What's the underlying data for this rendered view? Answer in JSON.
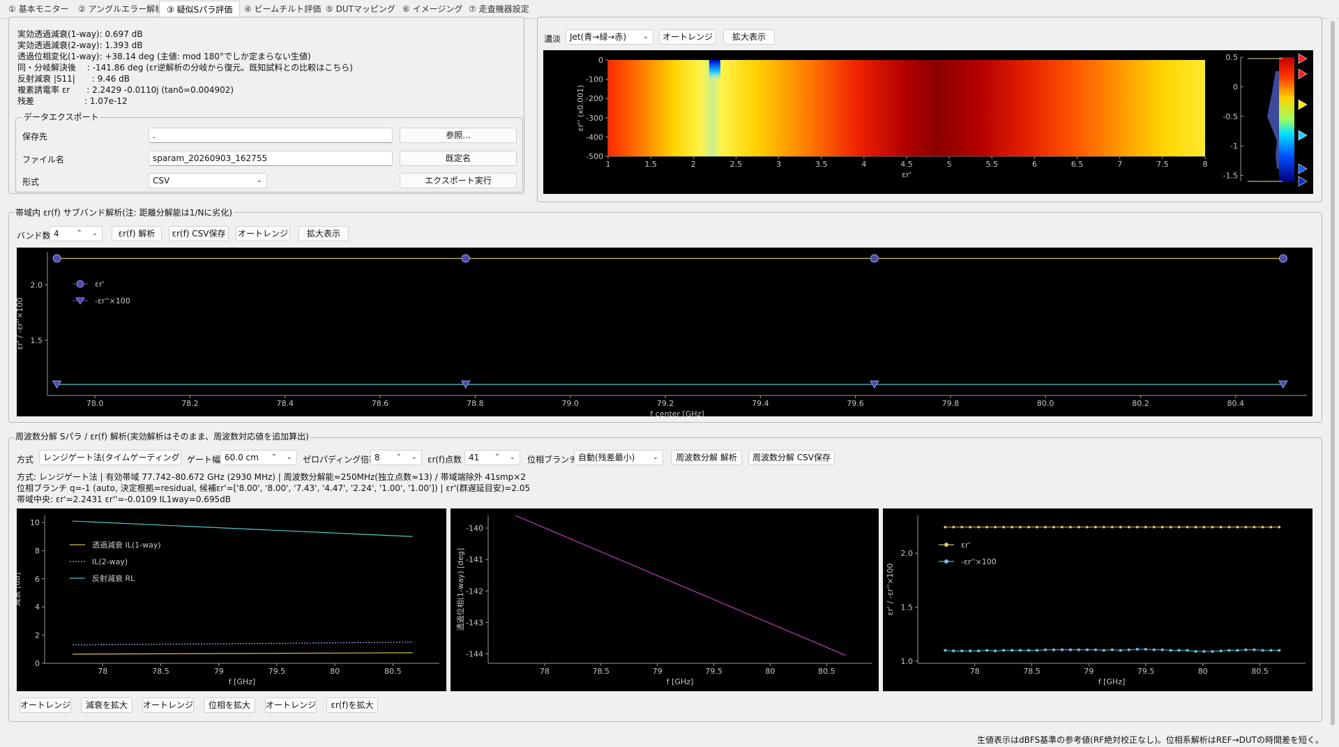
{
  "tabs": [
    "① 基本モニター",
    "② アングルエラー解析",
    "③ 疑似Sパラ評価",
    "④ ビームチルト評価",
    "⑤ DUTマッピング",
    "⑥ イメージング",
    "⑦ 走査機器設定"
  ],
  "results": {
    "lines": [
      "実効透過減衰(1-way): 0.697 dB",
      "実効透過減衰(2-way): 1.393 dB",
      "透過位相変化(1-way): +38.14 deg (主値: mod 180°でしか定まらない生値)",
      "同・分岐解決後　 : -141.86 deg (εr逆解析の分岐から復元。既知試料との比較はこちら)",
      "反射減衰 |S11|　　: 9.46 dB",
      "複素誘電率 εr　　: 2.2429 -0.0110j (tanδ=0.004902)",
      "残差　　　　　　: 1.07e-12"
    ]
  },
  "export": {
    "title": "データエクスポート",
    "save_dest_label": "保存先",
    "save_dest_value": ".",
    "browse_label": "参照...",
    "filename_label": "ファイル名",
    "filename_value": "sparam_20260903_162755",
    "default_name_label": "既定名",
    "format_label": "形式",
    "format_value": "CSV",
    "export_label": "エクスポート実行"
  },
  "heatmap_panel": {
    "colormap_label": "濃淡",
    "colormap_value": "Jet(青→緑→赤)",
    "autorange_label": "オートレンジ",
    "zoom_label": "拡大表示"
  },
  "subband": {
    "title": "帯域内 εr(f) サブバンド解析(注: 距離分解能は1/Nに劣化)",
    "bands_label": "バンド数",
    "bands_value": "4",
    "analyze_label": "εr(f) 解析",
    "csv_label": "εr(f) CSV保存",
    "autorange_label": "オートレンジ",
    "zoom_label": "拡大表示"
  },
  "freq": {
    "title": "周波数分解 Sパラ / εr(f) 解析(実効解析はそのまま、周波数対応値を追加算出)",
    "method_label": "方式",
    "method_value": "レンジゲート法(タイムゲーティング)",
    "gate_label": "ゲート幅",
    "gate_value": "60.0 cm",
    "zp_label": "ゼロパディング倍率",
    "zp_value": "8",
    "pts_label": "εr(f)点数",
    "pts_value": "41",
    "branch_label": "位相ブランチ",
    "branch_value": "自動(残差最小)",
    "analyze_label": "周波数分解 解析",
    "csv_label": "周波数分解 CSV保存",
    "info": [
      "方式: レンジゲート法 | 有効帯域 77.742–80.672 GHz (2930 MHz) | 周波数分解能≈250MHz(独立点数≈13) / 帯域端除外 41smp×2",
      "位相ブランチ q=-1 (auto, 決定根拠=residual, 候補εr'=['8.00', '8.00', '7.43', '4.47', '2.24', '1.00', '1.00']) | εr'(群遅延目安)=2.05",
      "帯域中央: εr'=2.2431 εr''=-0.0109 IL1way=0.695dB"
    ],
    "bottom_buttons": [
      "オートレンジ",
      "減衰を拡大",
      "オートレンジ",
      "位相を拡大",
      "オートレンジ",
      "εr(f)を拡大"
    ]
  },
  "status_text": "生値表示はdBFS基準の参考値(RF絶対校正なし)。位相系解析はREF→DUTの時間差を短く。",
  "colors": {
    "plot_bg": "#000000",
    "yellow": "#d4c24a",
    "cyan": "#4fc7c7",
    "magenta": "#c23bc2",
    "marker_fill": "#4b4ba8"
  },
  "chart_data": [
    {
      "id": "heatmap",
      "type": "heatmap",
      "xlabel": "εr'",
      "ylabel": "εr'' (x0.001)",
      "xticks": [
        "1",
        "1.5",
        "2",
        "2.5",
        "3",
        "3.5",
        "4",
        "4.5",
        "5",
        "5.5",
        "6",
        "6.5",
        "7",
        "7.5",
        "8"
      ],
      "yticks": [
        "0",
        "-100",
        "-200",
        "-300",
        "-400",
        "-500"
      ],
      "xlim": [
        1,
        8
      ],
      "ylim": [
        -500,
        0
      ],
      "minimum_at": {
        "x": 2.25,
        "y": 0
      },
      "colorbar_ticks": [
        "0.5",
        "0",
        "-0.5",
        "-1",
        "-1.5"
      ],
      "colorbar_range": [
        -1.6,
        0.5
      ],
      "colormap": "jet"
    },
    {
      "id": "subband",
      "type": "line",
      "xlabel": "f center [GHz]",
      "ylabel": "εr' / -εr''×100",
      "xticks": [
        "78.0",
        "78.2",
        "78.4",
        "78.6",
        "78.8",
        "79.0",
        "79.2",
        "79.4",
        "79.6",
        "79.8",
        "80.0",
        "80.2",
        "80.4"
      ],
      "yticks": [
        "2.0",
        "1.5"
      ],
      "xlim": [
        77.9,
        80.55
      ],
      "ylim": [
        1.0,
        2.3
      ],
      "legend": [
        "εr'",
        "-εr''×100"
      ],
      "legend_placement": "top-left",
      "series": [
        {
          "name": "εr'",
          "x": [
            77.92,
            78.78,
            79.64,
            80.5
          ],
          "y": [
            2.24,
            2.24,
            2.24,
            2.24
          ]
        },
        {
          "name": "-εr''×100",
          "x": [
            77.92,
            78.78,
            79.64,
            80.5
          ],
          "y": [
            1.1,
            1.1,
            1.1,
            1.1
          ]
        }
      ]
    },
    {
      "id": "attenuation",
      "type": "line",
      "xlabel": "f [GHz]",
      "ylabel": "減衰 [dB]",
      "xticks": [
        "78",
        "78.5",
        "79",
        "79.5",
        "80",
        "80.5"
      ],
      "yticks": [
        "10",
        "8",
        "6",
        "4",
        "2",
        "0"
      ],
      "xlim": [
        77.5,
        80.9
      ],
      "ylim": [
        0,
        10.5
      ],
      "legend": [
        "透過減衰 IL(1-way)",
        "IL(2-way)",
        "反射減衰 RL"
      ],
      "legend_placement": "top-left",
      "series": [
        {
          "name": "透過減衰 IL(1-way)",
          "x": [
            77.74,
            80.67
          ],
          "y": [
            0.65,
            0.75
          ]
        },
        {
          "name": "IL(2-way)",
          "x": [
            77.74,
            80.67
          ],
          "y": [
            1.3,
            1.5
          ]
        },
        {
          "name": "反射減衰 RL",
          "x": [
            77.74,
            80.67
          ],
          "y": [
            10.1,
            9.0
          ]
        }
      ]
    },
    {
      "id": "phase",
      "type": "line",
      "xlabel": "f [GHz]",
      "ylabel": "透過位相(1-way) [deg]",
      "xticks": [
        "78",
        "78.5",
        "79",
        "79.5",
        "80",
        "80.5"
      ],
      "yticks": [
        "-140",
        "-141",
        "-142",
        "-143",
        "-144"
      ],
      "xlim": [
        77.5,
        80.9
      ],
      "ylim": [
        -144.3,
        -139.6
      ],
      "series": [
        {
          "name": "透過位相",
          "x": [
            77.74,
            80.67
          ],
          "y": [
            -139.6,
            -144.05
          ]
        }
      ]
    },
    {
      "id": "er_f",
      "type": "line",
      "xlabel": "f [GHz]",
      "ylabel": "εr' / -εr''×100",
      "xticks": [
        "78",
        "78.5",
        "79",
        "79.5",
        "80",
        "80.5"
      ],
      "yticks": [
        "2.0",
        "1.5",
        "1.0"
      ],
      "xlim": [
        77.5,
        80.9
      ],
      "ylim": [
        0.98,
        2.35
      ],
      "legend": [
        "εr'",
        "-εr''×100"
      ],
      "legend_placement": "top-left",
      "series": [
        {
          "name": "εr'",
          "x_range": [
            77.74,
            80.67
          ],
          "n": 41,
          "y": [
            2.242,
            2.242,
            2.242,
            2.242,
            2.242,
            2.242,
            2.242,
            2.242,
            2.242,
            2.242,
            2.242,
            2.242,
            2.242,
            2.242,
            2.242,
            2.242,
            2.242,
            2.242,
            2.242,
            2.242,
            2.242,
            2.242,
            2.242,
            2.242,
            2.242,
            2.242,
            2.242,
            2.242,
            2.242,
            2.242,
            2.242,
            2.242,
            2.242,
            2.242,
            2.242,
            2.242,
            2.242,
            2.242,
            2.242,
            2.242,
            2.242
          ]
        },
        {
          "name": "-εr''×100",
          "x_range": [
            77.74,
            80.67
          ],
          "n": 41,
          "y": [
            1.1,
            1.095,
            1.095,
            1.095,
            1.095,
            1.1,
            1.095,
            1.1,
            1.1,
            1.1,
            1.1,
            1.1,
            1.105,
            1.105,
            1.105,
            1.105,
            1.105,
            1.105,
            1.105,
            1.1,
            1.105,
            1.1,
            1.105,
            1.11,
            1.11,
            1.105,
            1.105,
            1.1,
            1.1,
            1.1,
            1.09,
            1.09,
            1.09,
            1.095,
            1.1,
            1.1,
            1.105,
            1.105,
            1.1,
            1.1,
            1.1
          ]
        }
      ]
    }
  ]
}
